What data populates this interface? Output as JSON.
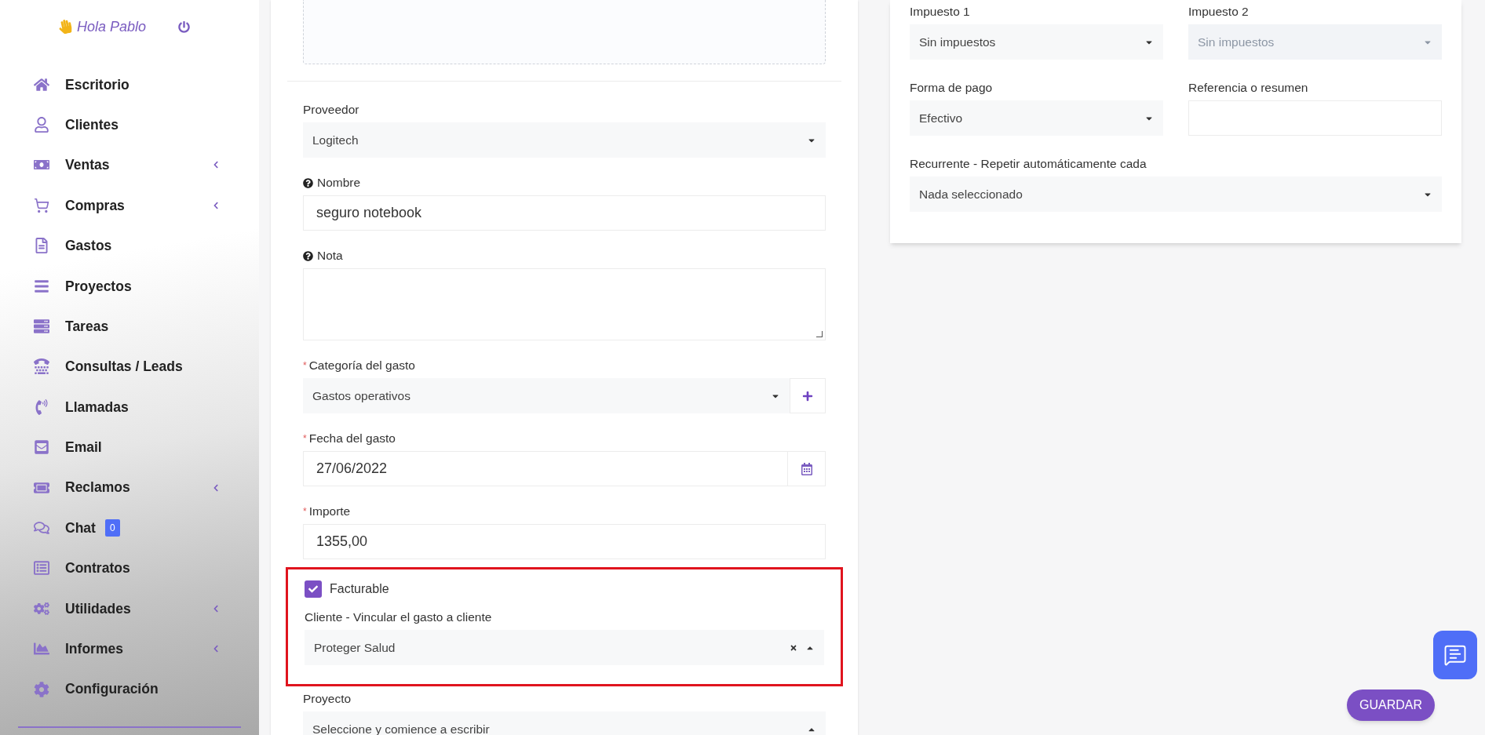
{
  "sidebar": {
    "greeting": "Hola Pablo",
    "items": [
      {
        "label": "Escritorio",
        "expandable": false
      },
      {
        "label": "Clientes",
        "expandable": false
      },
      {
        "label": "Ventas",
        "expandable": true
      },
      {
        "label": "Compras",
        "expandable": true
      },
      {
        "label": "Gastos",
        "expandable": false
      },
      {
        "label": "Proyectos",
        "expandable": false
      },
      {
        "label": "Tareas",
        "expandable": false
      },
      {
        "label": "Consultas / Leads",
        "expandable": false
      },
      {
        "label": "Llamadas",
        "expandable": false
      },
      {
        "label": "Email",
        "expandable": false
      },
      {
        "label": "Reclamos",
        "expandable": true
      },
      {
        "label": "Chat",
        "expandable": false,
        "badge": "0"
      },
      {
        "label": "Contratos",
        "expandable": false
      },
      {
        "label": "Utilidades",
        "expandable": true
      },
      {
        "label": "Informes",
        "expandable": true
      },
      {
        "label": "Configuración",
        "expandable": false
      }
    ]
  },
  "expense_form": {
    "fields": [
      {
        "kind": "select",
        "label": "Proveedor",
        "value": "Logitech"
      },
      {
        "kind": "input",
        "label": "Nombre",
        "value": "seguro notebook",
        "help": true
      },
      {
        "kind": "textarea",
        "label": "Nota",
        "help": true
      },
      {
        "kind": "select_add",
        "label": "Categoría del gasto",
        "value": "Gastos operativos",
        "required_mark": "*"
      },
      {
        "kind": "date",
        "label": "Fecha del gasto",
        "value": "27/06/2022",
        "required_mark": "*"
      },
      {
        "kind": "input",
        "label": "Importe",
        "value": "1355,00",
        "required_mark": "*"
      },
      {
        "kind": "group",
        "highlighted": true,
        "children": [
          {
            "kind": "checkbox",
            "label": "Facturable",
            "checked": true
          },
          {
            "kind": "select",
            "label": "Cliente - Vincular el gasto a cliente",
            "value": "Proteger Salud",
            "clearable": true,
            "expanded": true
          }
        ]
      },
      {
        "kind": "select",
        "label": "Proyecto",
        "value": "Seleccione y comience a escribir",
        "expanded": true
      }
    ]
  },
  "options_form": {
    "rows": [
      [
        {
          "kind": "select",
          "label": "Impuesto 1",
          "value": "Sin impuestos",
          "disabled": false
        },
        {
          "kind": "select",
          "label": "Impuesto 2",
          "value": "Sin impuestos",
          "disabled": true
        }
      ],
      [
        {
          "kind": "select",
          "label": "Forma de pago",
          "value": "Efectivo",
          "disabled": false
        },
        {
          "kind": "input",
          "label": "Referencia o resumen",
          "disabled": false
        }
      ],
      [
        {
          "kind": "select",
          "label": "Recurrente - Repetir automáticamente cada",
          "value": "Nada seleccionado",
          "disabled": false
        }
      ]
    ]
  },
  "save_button": "GUARDAR"
}
